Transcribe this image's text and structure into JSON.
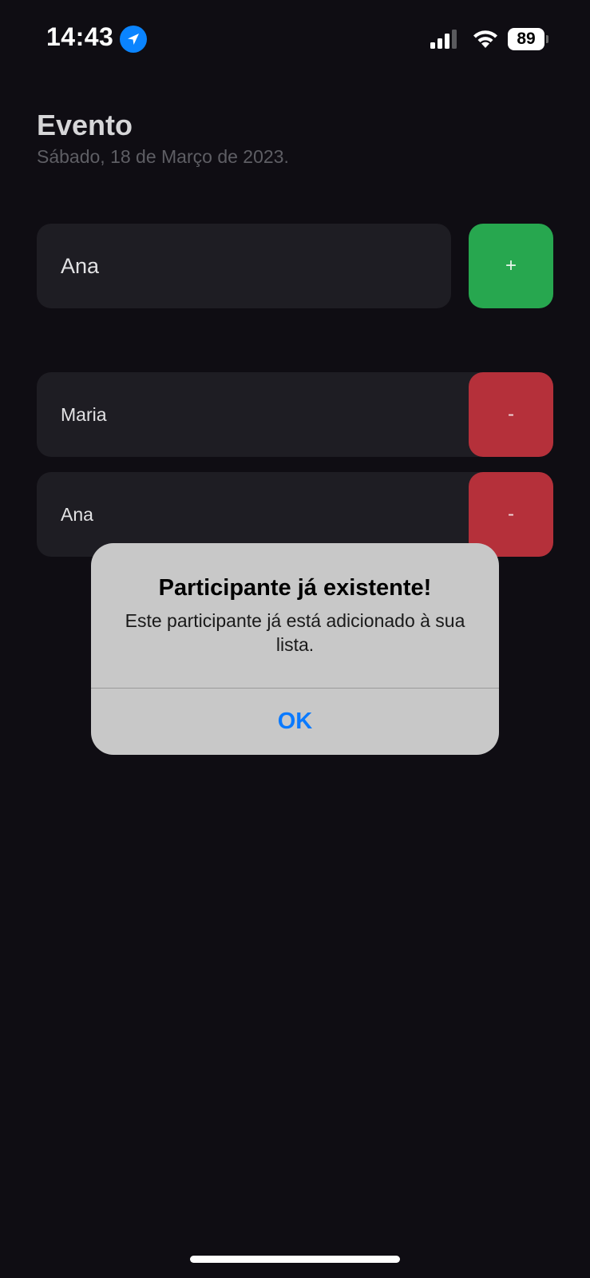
{
  "status_bar": {
    "time": "14:43",
    "battery": "89",
    "icons": [
      "location-arrow-icon",
      "cellular-signal-icon",
      "wifi-icon",
      "battery-icon"
    ]
  },
  "header": {
    "title": "Evento",
    "subtitle": "Sábado, 18 de Março de 2023."
  },
  "form": {
    "input_value": "Ana",
    "add_label": "+"
  },
  "participants": [
    {
      "name": "Maria",
      "remove_label": "-"
    },
    {
      "name": "Ana",
      "remove_label": "-"
    }
  ],
  "alert": {
    "title": "Participante já existente!",
    "message": "Este participante já está adicionado à sua lista.",
    "ok_label": "OK"
  },
  "colors": {
    "background": "#0F0D13",
    "card": "#1E1D23",
    "add_green": "#27A74F",
    "remove_red": "#B5303A",
    "alert_bg": "#C8C8C8",
    "ios_blue": "#0A7AFF"
  }
}
